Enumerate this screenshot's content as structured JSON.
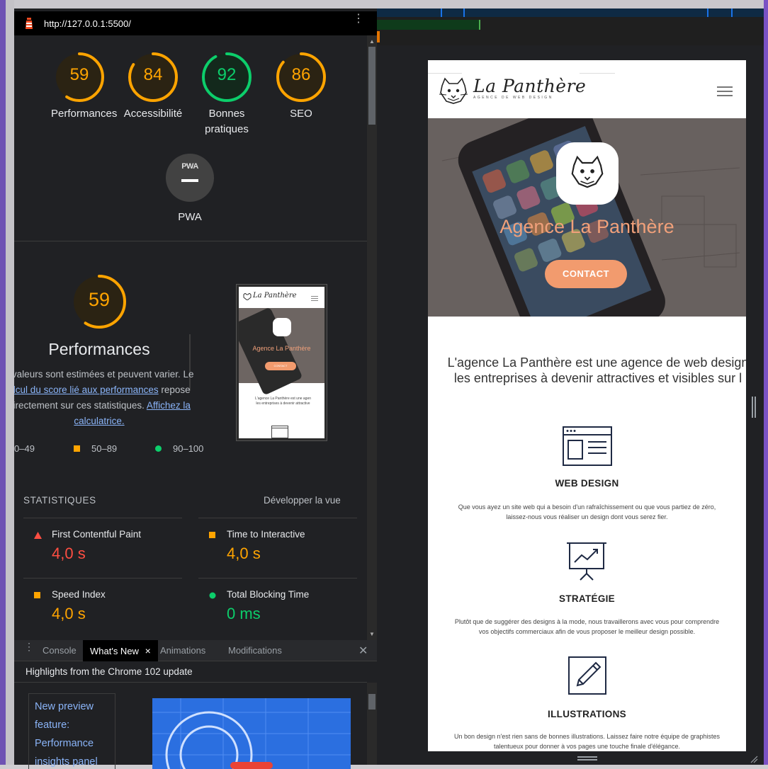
{
  "lighthouse": {
    "url": "http://127.0.0.1:5500/",
    "gauges": [
      {
        "score": "59",
        "label": "Performances",
        "color": "#ffa400",
        "fraction": 0.59
      },
      {
        "score": "84",
        "label": "Accessibilité",
        "color": "#ffa400",
        "fraction": 0.84
      },
      {
        "score": "92",
        "label_line1": "Bonnes",
        "label_line2": "pratiques",
        "color": "#0cce6b",
        "fraction": 0.92
      },
      {
        "score": "86",
        "label": "SEO",
        "color": "#ffa400",
        "fraction": 0.86
      }
    ],
    "pwa": {
      "badge": "PWA",
      "label": "PWA"
    },
    "performance": {
      "score": "59",
      "fraction": 0.59,
      "title": "Performances",
      "desc_part1": "s valeurs sont estimées et peuvent varier. Le",
      "desc_link1": "alcul du score lié aux performances",
      "desc_part2": " repose",
      "desc_part3": "directement sur ces statistiques. ",
      "desc_link2": "Affichez la",
      "desc_link3": "calculatrice."
    },
    "legend": [
      {
        "range": "0–49",
        "color": "#ff4e42"
      },
      {
        "range": "50–89",
        "color": "#ffa400"
      },
      {
        "range": "90–100",
        "color": "#0cce6b"
      }
    ],
    "stats_header": "STATISTIQUES",
    "stats_expand": "Développer la vue",
    "stats": [
      {
        "name": "First Contentful Paint",
        "value": "4,0 s",
        "color": "#ff4e42",
        "marker": "triangle"
      },
      {
        "name": "Time to Interactive",
        "value": "4,0 s",
        "color": "#ffa400",
        "marker": "square"
      },
      {
        "name": "Speed Index",
        "value": "4,0 s",
        "color": "#ffa400",
        "marker": "square"
      },
      {
        "name": "Total Blocking Time",
        "value": "0 ms",
        "color": "#0cce6b",
        "marker": "circle"
      }
    ],
    "thumbnail": {
      "brand": "La Panthère",
      "hero_title": "Agence La Panthère",
      "button": "CONTACT",
      "intro_line1": "L'agence La Panthère est une agen",
      "intro_line2": "les entreprises à devenir attractive"
    }
  },
  "drawer": {
    "tabs": [
      {
        "label": "Console",
        "active": false
      },
      {
        "label": "What's New",
        "active": true
      },
      {
        "label": "Animations",
        "active": false
      },
      {
        "label": "Modifications",
        "active": false
      }
    ],
    "tab_close": "×",
    "close": "✕",
    "headline": "Highlights from the Chrome 102 update",
    "card_text": "New preview feature: Performance insights panel"
  },
  "site": {
    "brand": "La Panthère",
    "tagline": "AGENCE DE WEB DESIGN",
    "hero_title": "Agence La Panthère",
    "contact_button": "CONTACT",
    "intro_line1": "L'agence La Panthère est une agence de web design",
    "intro_line2": "les entreprises à devenir attractives et visibles sur l",
    "services": [
      {
        "icon": "web-design-icon",
        "title": "WEB DESIGN",
        "text1": "Que vous ayez un site web qui a besoin d'un rafraîchissement ou que vous partiez de zéro,",
        "text2": "laissez-nous vous réaliser un design dont vous serez fier."
      },
      {
        "icon": "strategy-chart-icon",
        "title": "STRATÉGIE",
        "text1": "Plutôt que de suggérer des designs à la mode, nous travaillerons avec vous pour comprendre",
        "text2": "vos objectifs commerciaux afin de vous proposer le meilleur design possible."
      },
      {
        "icon": "pencil-icon",
        "title": "ILLUSTRATIONS",
        "text1": "Un bon design n'est rien sans de bonnes illustrations. Laissez faire notre équipe de graphistes",
        "text2": "talentueux pour donner à vos pages une touche finale d'élégance."
      }
    ]
  }
}
